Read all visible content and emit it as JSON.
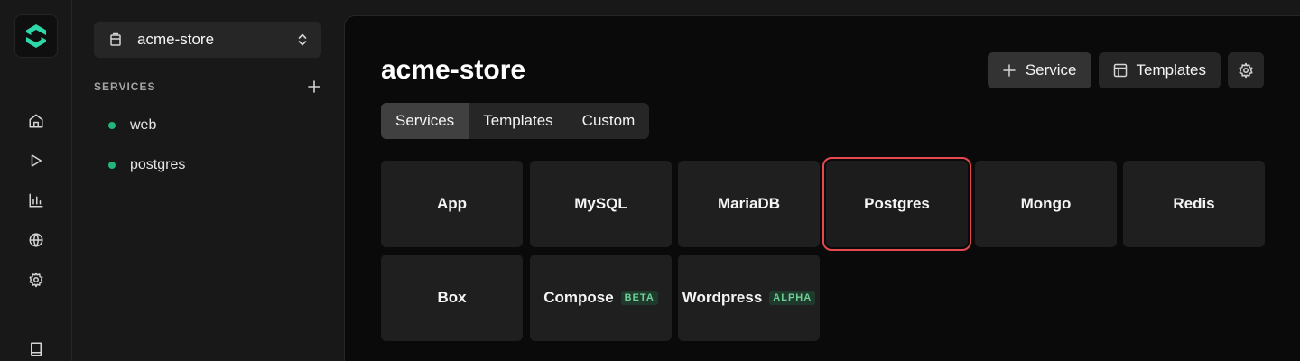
{
  "rail": {
    "logo": "logo-mark",
    "items": [
      {
        "icon": "home-icon"
      },
      {
        "icon": "play-icon"
      },
      {
        "icon": "chart-icon"
      },
      {
        "icon": "globe-icon"
      },
      {
        "icon": "gear-icon"
      },
      {
        "icon": "book-icon"
      }
    ]
  },
  "sidebar": {
    "project_name": "acme-store",
    "section_title": "SERVICES",
    "services": [
      {
        "label": "web",
        "status_color": "#22b67a"
      },
      {
        "label": "postgres",
        "status_color": "#22b67a"
      }
    ]
  },
  "main": {
    "title": "acme-store",
    "actions": {
      "service_label": "Service",
      "templates_label": "Templates"
    },
    "tabs": [
      {
        "label": "Services",
        "active": true
      },
      {
        "label": "Templates",
        "active": false
      },
      {
        "label": "Custom",
        "active": false
      }
    ],
    "cards": [
      {
        "label": "App"
      },
      {
        "label": "MySQL"
      },
      {
        "label": "MariaDB"
      },
      {
        "label": "Postgres",
        "selected": true
      },
      {
        "label": "Mongo"
      },
      {
        "label": "Redis"
      },
      {
        "label": "Box"
      },
      {
        "label": "Compose",
        "badge": "BETA"
      },
      {
        "label": "Wordpress",
        "badge": "ALPHA"
      }
    ]
  },
  "colors": {
    "accent_green": "#22b67a",
    "selection_red": "#e5484d"
  }
}
